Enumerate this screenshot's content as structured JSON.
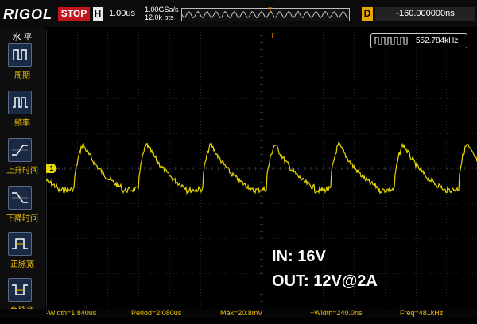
{
  "topbar": {
    "logo": "RIGOL",
    "status": "STOP",
    "horizontal_key": "H",
    "timebase": "1.00us",
    "sample_rate": "1.00GSa/s",
    "memory_points": "12.0k pts",
    "delay_key": "D",
    "delay_value": "-160.000000ns"
  },
  "sidebar": {
    "title": "水 平",
    "items": [
      {
        "label": "周期",
        "icon": "period-icon"
      },
      {
        "label": "频率",
        "icon": "frequency-icon"
      },
      {
        "label": "上升时间",
        "icon": "rise-time-icon"
      },
      {
        "label": "下降时间",
        "icon": "fall-time-icon"
      },
      {
        "label": "正脉宽",
        "icon": "positive-width-icon"
      },
      {
        "label": "负脉宽",
        "icon": "negative-width-icon"
      }
    ]
  },
  "plot": {
    "trigger_marker": "T",
    "channel_marker": "1",
    "frequency_counter": "552.784kHz",
    "annotation_in": "IN: 16V",
    "annotation_out": "OUT: 12V@2A"
  },
  "measurements": [
    {
      "text": "-Width=1.840us"
    },
    {
      "text": "Period=2.080us"
    },
    {
      "text": "Max=20.8mV"
    },
    {
      "text": "+Width=240.0ns"
    },
    {
      "text": "Freq=481kHz"
    }
  ],
  "colors": {
    "channel1": "#e6d800",
    "trigger": "#f08a00",
    "stop": "#c0161c",
    "grid": "#444444"
  }
}
